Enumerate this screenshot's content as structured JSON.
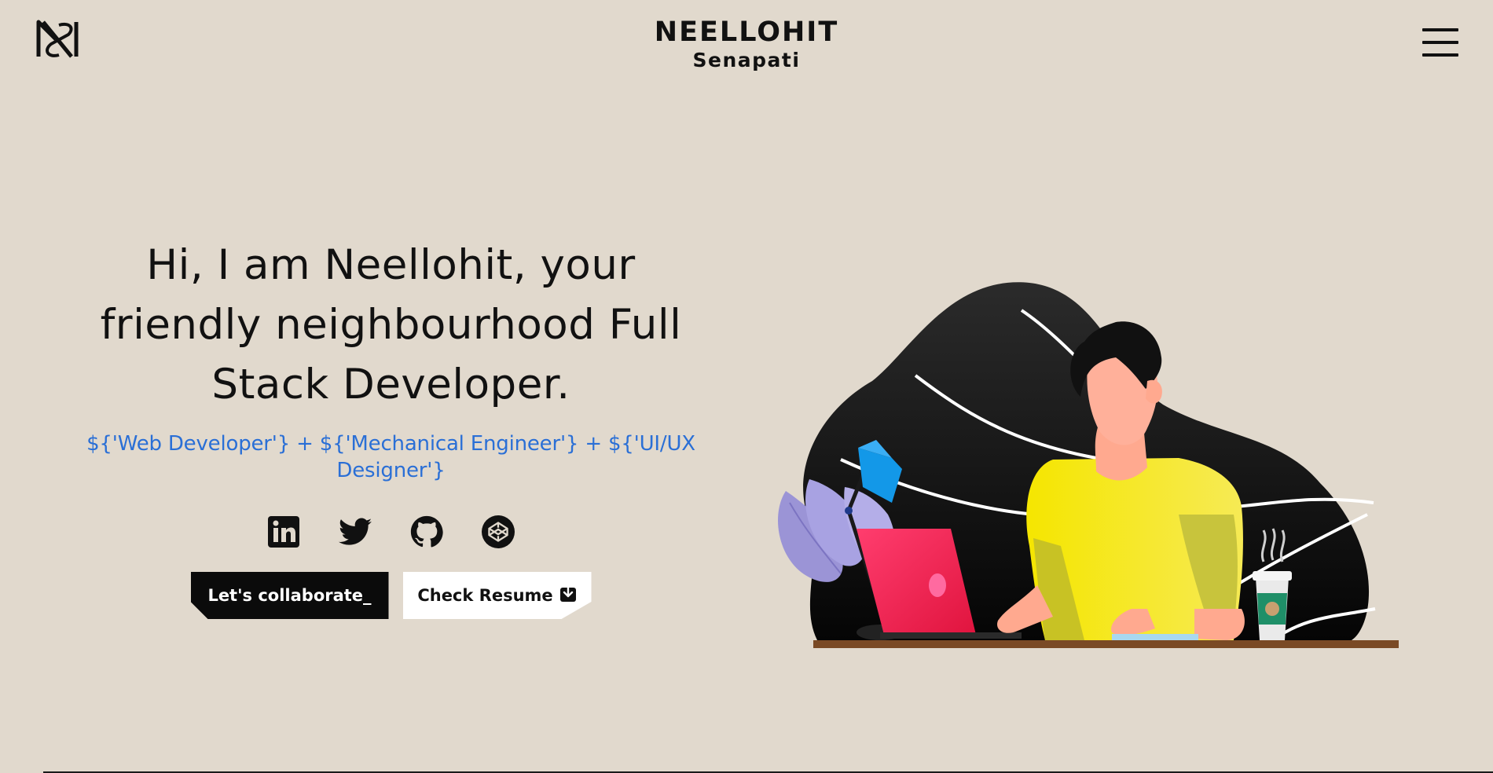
{
  "header": {
    "logo_icon": "ns-monogram-logo-icon",
    "brand_name": "NEELLOHIT",
    "brand_sub": "Senapati",
    "menu_icon": "hamburger-menu-icon"
  },
  "hero": {
    "title": "Hi, I am Neellohit, your friendly neighbourhood Full Stack Developer.",
    "subtitle": "${'Web Developer'} + ${'Mechanical Engineer'} + ${'UI/UX Designer'}",
    "subtitle_color": "#2a6fd6"
  },
  "socials": [
    {
      "icon": "linkedin-icon"
    },
    {
      "icon": "twitter-icon"
    },
    {
      "icon": "github-icon"
    },
    {
      "icon": "codepen-icon"
    }
  ],
  "actions": {
    "collaborate_label": "Let's collaborate_",
    "resume_label": "Check Resume",
    "resume_icon": "download-icon"
  },
  "illustration": {
    "icon": "developer-at-laptop-illustration"
  },
  "colors": {
    "background": "#e1d9cd",
    "accent": "#2a6fd6",
    "dark": "#0b0b0b"
  }
}
